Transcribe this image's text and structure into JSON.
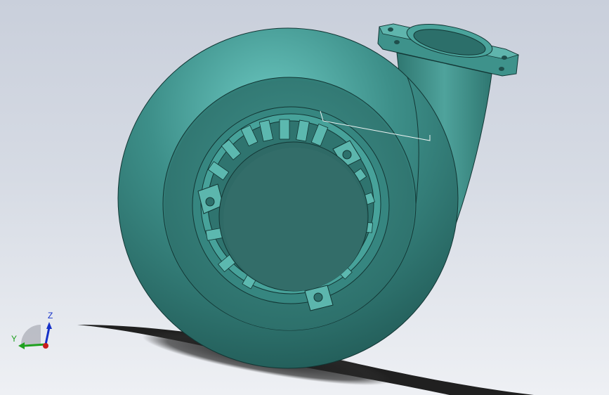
{
  "viewport": {
    "background_top": "#c9cfdb",
    "background_bottom": "#eef0f4"
  },
  "model": {
    "part": "turbine-housing",
    "body_color": "#3a8c86",
    "shadow_color": "#1e1e1e",
    "edge_color": "#123634"
  },
  "triad": {
    "z_label": "Z",
    "y_label": "Y",
    "z_color": "#1530c8",
    "y_color": "#1fa01f",
    "x_color": "#c81e1e"
  }
}
